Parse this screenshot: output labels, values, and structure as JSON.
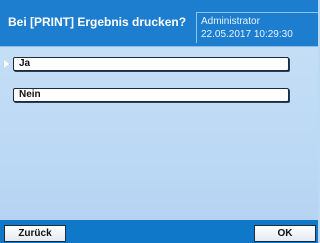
{
  "header": {
    "title": "Bei [PRINT] Ergebnis drucken?",
    "user": "Administrator",
    "datetime": "22.05.2017 10:29:30"
  },
  "options": [
    {
      "label": "Ja",
      "selected": true
    },
    {
      "label": "Nein",
      "selected": false
    }
  ],
  "footer": {
    "back_label": "Zurück",
    "ok_label": "OK"
  },
  "colors": {
    "header_bg": "#1d7ed0",
    "body_bg": "#bcd9f5",
    "footer_bg": "#0f78c8"
  }
}
